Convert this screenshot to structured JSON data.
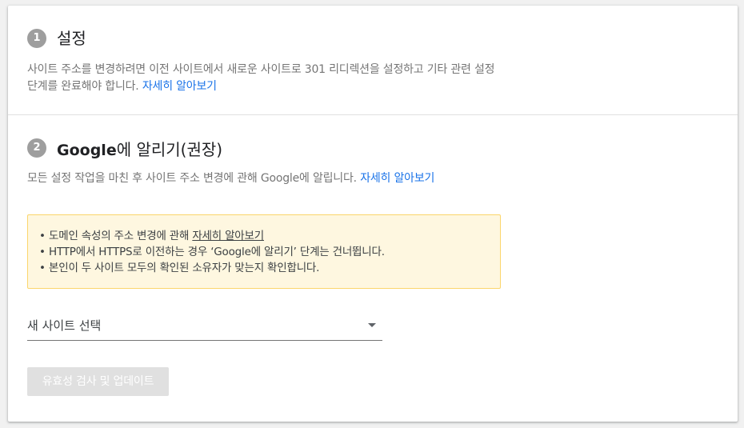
{
  "step1": {
    "number": "1",
    "title": "설정",
    "description": "사이트 주소를 변경하려면 이전 사이트에서 새로운 사이트로 301 리디렉션을 설정하고 기타 관련 설정 단계를 완료해야 합니다.",
    "link": "자세히 알아보기"
  },
  "step2": {
    "number": "2",
    "title_brand": "Google",
    "title_rest": "에 알리기(권장)",
    "description": "모든 설정 작업을 마친 후 사이트 주소 변경에 관해 Google에 알립니다.",
    "link": "자세히 알아보기"
  },
  "notice": {
    "items": [
      {
        "bullet": "•",
        "text": "도메인 속성의 주소 변경에 관해 ",
        "link": "자세히 알아보기"
      },
      {
        "bullet": "•",
        "text": "HTTP에서 HTTPS로 이전하는 경우 ‘Google에 알리기’ 단계는 건너뜁니다."
      },
      {
        "bullet": "•",
        "text": "본인이 두 사이트 모두의 확인된 소유자가 맞는지 확인합니다."
      }
    ]
  },
  "site_select": {
    "label": "새 사이트 선택"
  },
  "validate_button": {
    "label": "유효성 검사 및 업데이트"
  },
  "colors": {
    "link": "#1a73e8",
    "badge": "#9e9e9e",
    "notice_bg": "#fef7e0",
    "notice_border": "#fbd56b",
    "button_disabled_bg": "#e0e0e0"
  }
}
